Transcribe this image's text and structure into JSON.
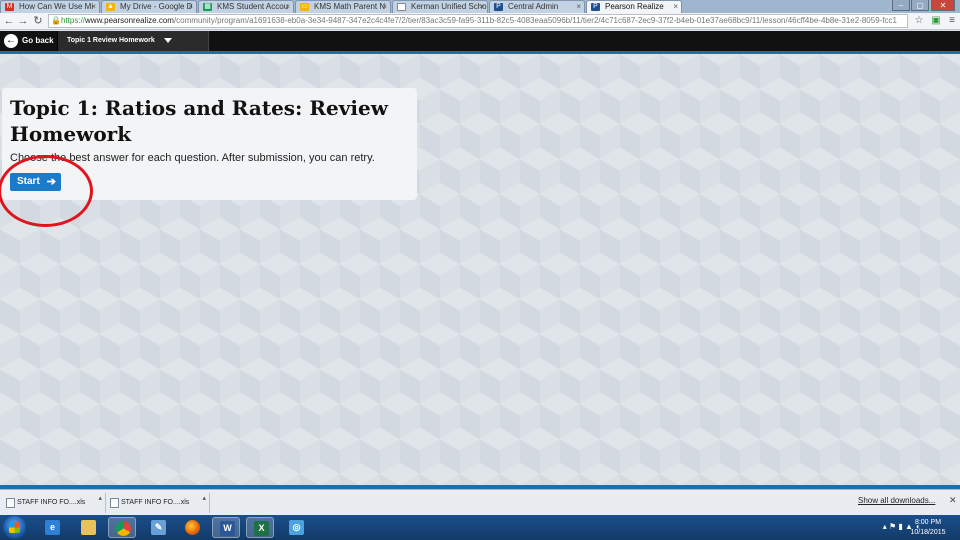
{
  "browser": {
    "tabs": [
      {
        "label": "How Can We Use Mi",
        "favicon": "gmail-icon",
        "color": "#d93025",
        "active": false
      },
      {
        "label": "My Drive - Google D",
        "favicon": "drive-icon",
        "color": "#f4b400",
        "active": false
      },
      {
        "label": "KMS Student Accou",
        "favicon": "sheets-icon",
        "color": "#0f9d58",
        "active": false
      },
      {
        "label": "KMS Math Parent N",
        "favicon": "slides-icon",
        "color": "#f4b400",
        "active": false
      },
      {
        "label": "Kerman Unified Scho",
        "favicon": "page-icon",
        "color": "#888888",
        "active": false
      },
      {
        "label": "Central Admin",
        "favicon": "pearson-icon",
        "color": "#1d4f91",
        "active": false
      },
      {
        "label": "Pearson Realize",
        "favicon": "pearson-icon",
        "color": "#1d4f91",
        "active": true
      }
    ],
    "url_scheme": "https://",
    "url_host": "www.pearsonrealize.com",
    "url_path": "/community/program/a1691638-eb0a-3e34-9487-347e2c4c4fe7/2/tier/83ac3c59-fa95-311b-82c5-4083eaa5096b/11/tier2/4c71c687-2ec9-37f2-b4eb-01e37ae68bc9/11/lesson/46cff4be-4b8e-31e2-8059-fcc1"
  },
  "app_header": {
    "go_back_label": "Go back",
    "lesson_title": "Topic 1 Review Homework"
  },
  "card": {
    "title": "Topic 1: Ratios and Rates: Review Homework",
    "description": "Choose the best answer for each question. After submission, you can retry.",
    "start_label": "Start"
  },
  "downloads": {
    "items": [
      "STAFF INFO FO....xls",
      "STAFF INFO FO....xls"
    ],
    "show_all_label": "Show all downloads..."
  },
  "taskbar": {
    "time": "8:00 PM",
    "date": "10/18/2015"
  },
  "colors": {
    "accent": "#1c7bc8",
    "header_bg": "#111111",
    "annotation_circle": "#e0141c"
  }
}
